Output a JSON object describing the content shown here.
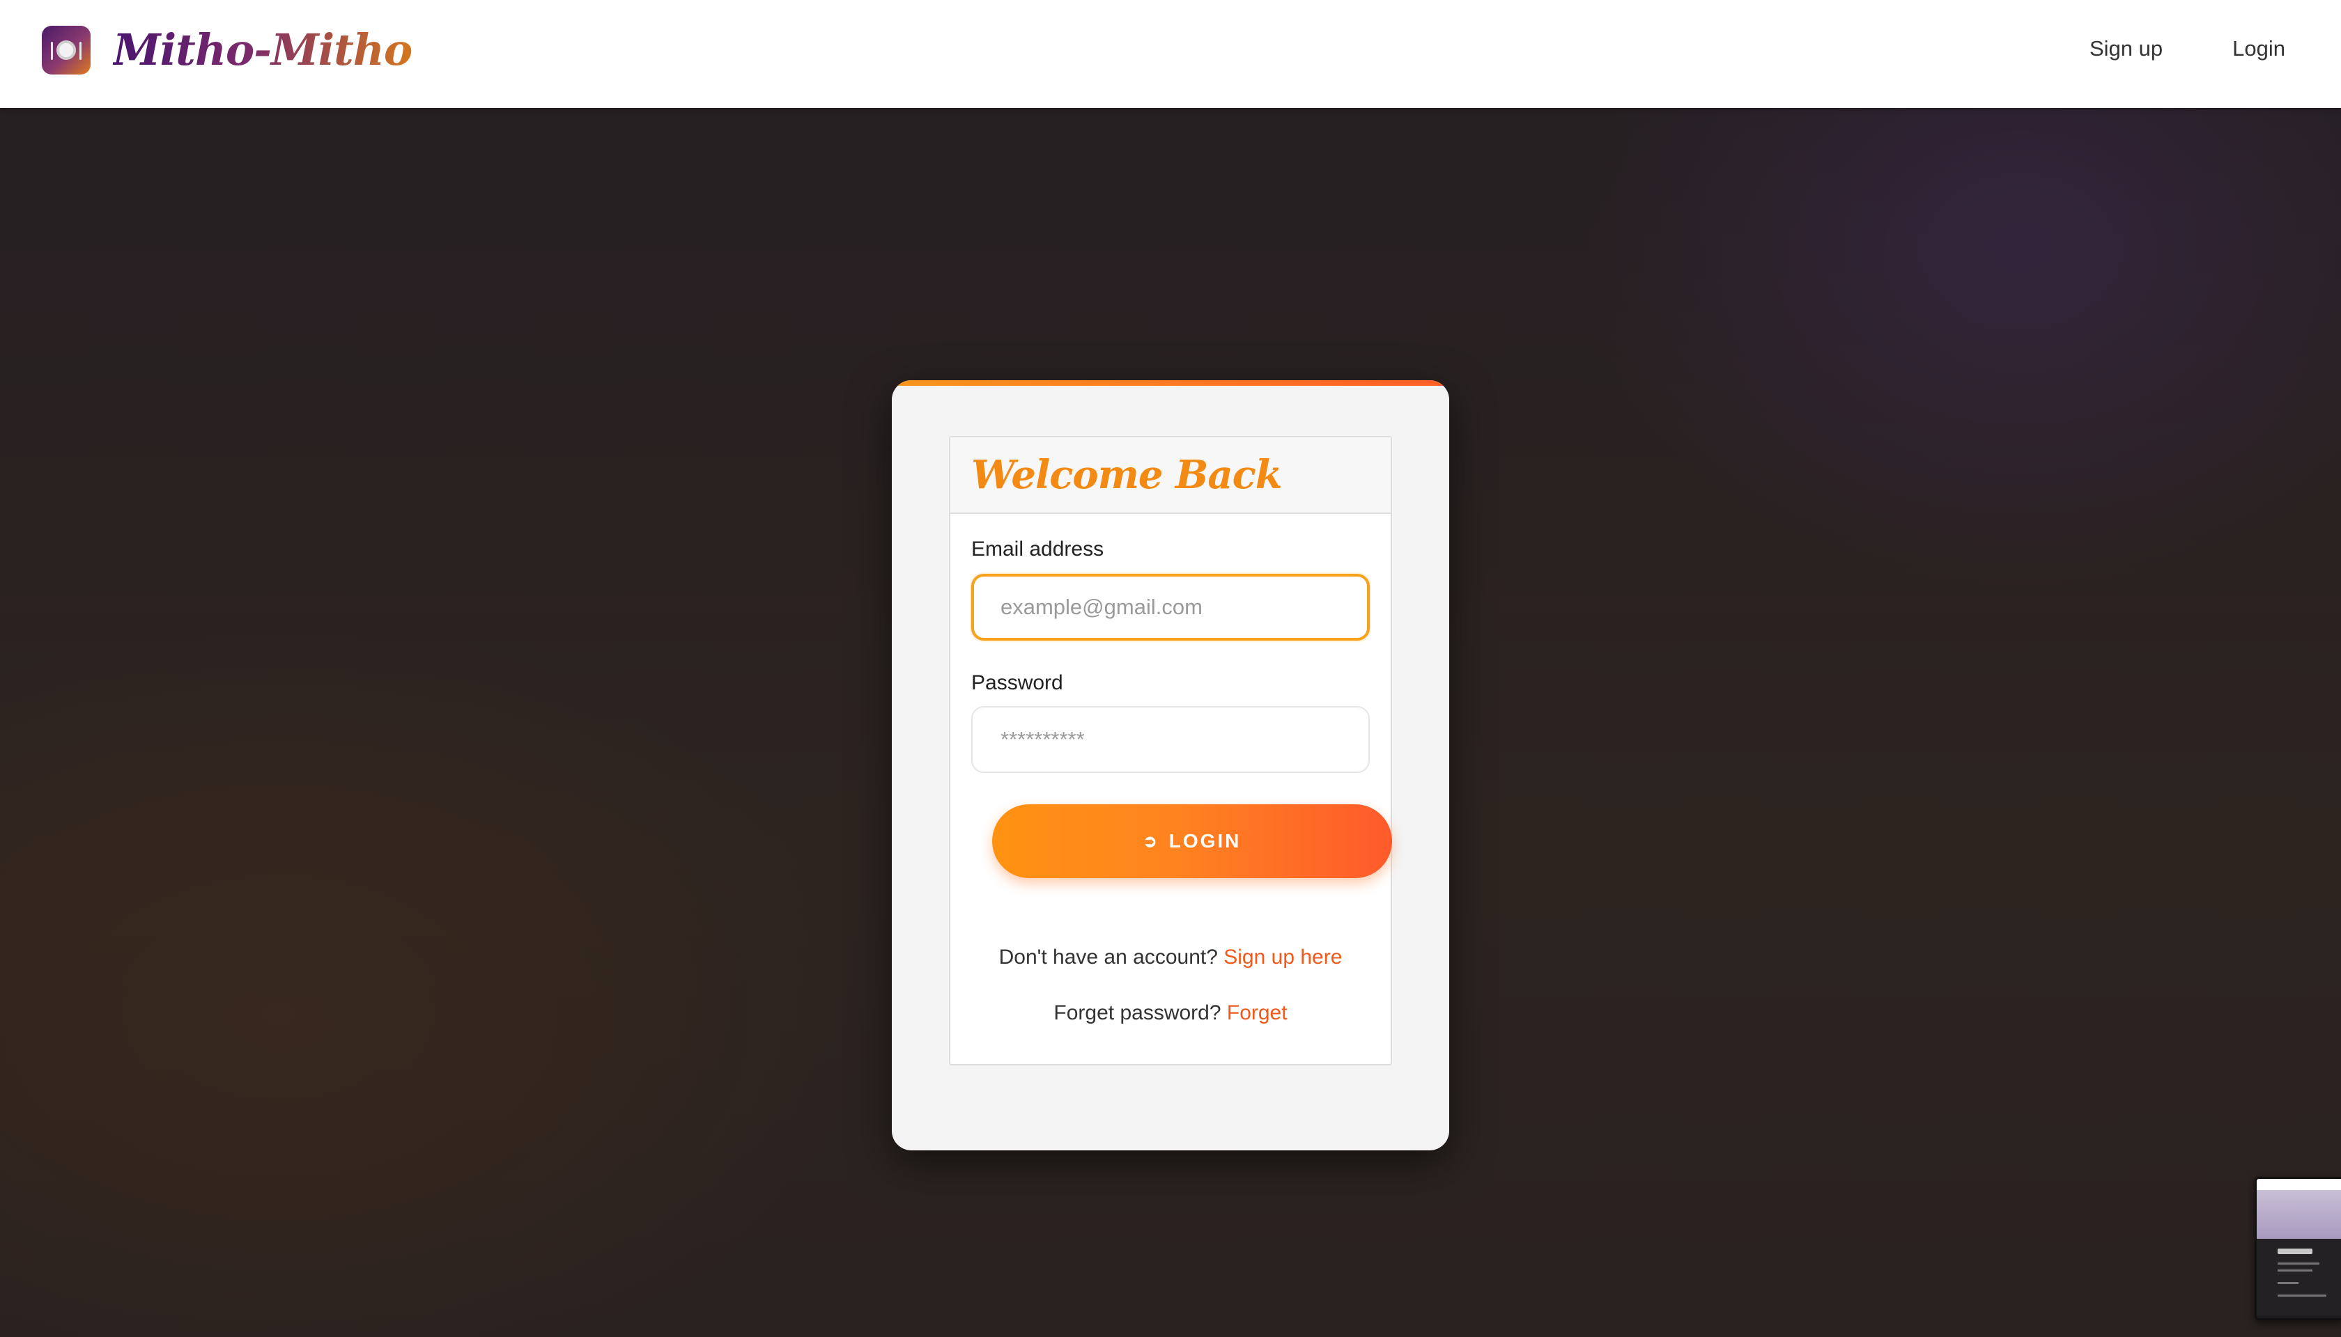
{
  "brand": {
    "name": "Mitho-Mitho",
    "logo_icon": "plate-cutlery-icon"
  },
  "nav": {
    "signup_label": "Sign up",
    "login_label": "Login"
  },
  "login_card": {
    "title": "Welcome Back",
    "email": {
      "label": "Email address",
      "placeholder": "example@gmail.com",
      "value": ""
    },
    "password": {
      "label": "Password",
      "placeholder": "**********",
      "value": ""
    },
    "login_button": {
      "label": "LOGIN",
      "icon": "sign-in-icon"
    },
    "signup_prompt": "Don't have an account?",
    "signup_link": "Sign up here",
    "forget_prompt": "Forget password?",
    "forget_link": "Forget"
  },
  "colors": {
    "accent_orange": "#f28a14",
    "accent_red_orange": "#ff5a2b",
    "link": "#f05a1a",
    "brand_purple": "#4a1570"
  }
}
